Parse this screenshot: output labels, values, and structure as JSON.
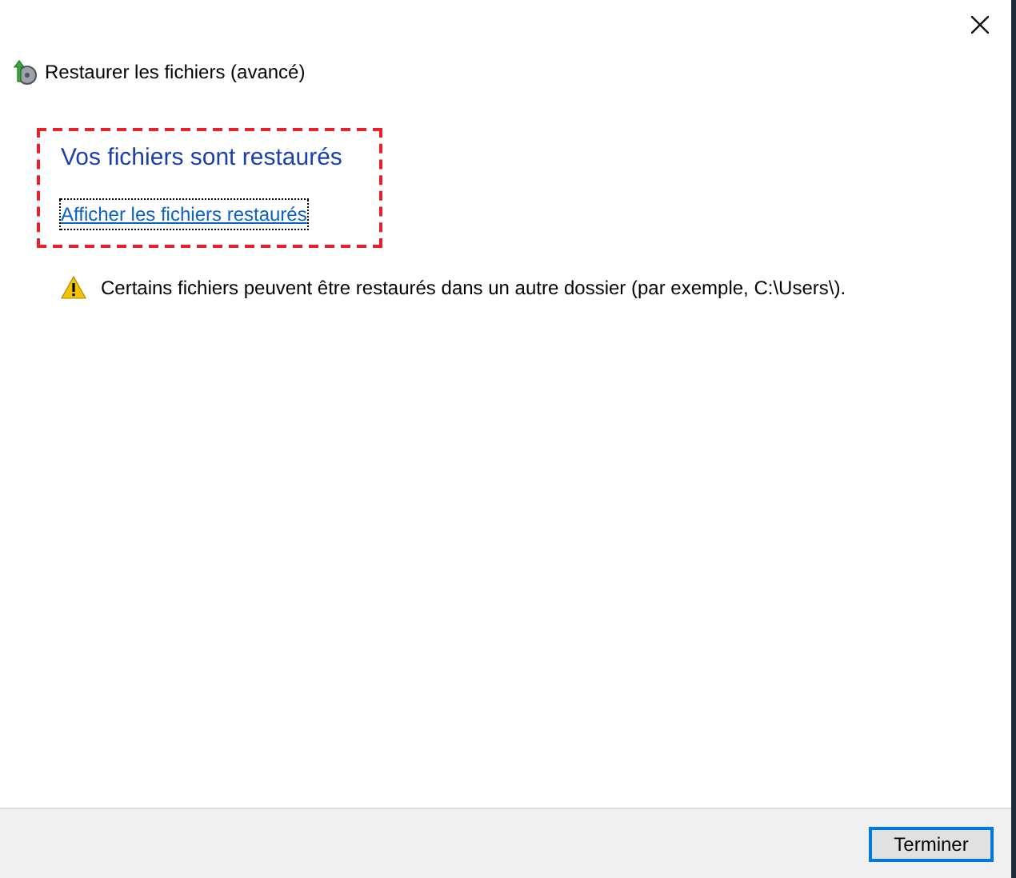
{
  "window": {
    "title": "Restaurer les fichiers (avancé)"
  },
  "heading": "Vos fichiers sont restaurés",
  "link": "Afficher les fichiers restaurés",
  "warning": "Certains fichiers peuvent être restaurés dans un autre dossier (par exemple, C:\\Users\\).",
  "buttons": [
    "Terminer"
  ]
}
